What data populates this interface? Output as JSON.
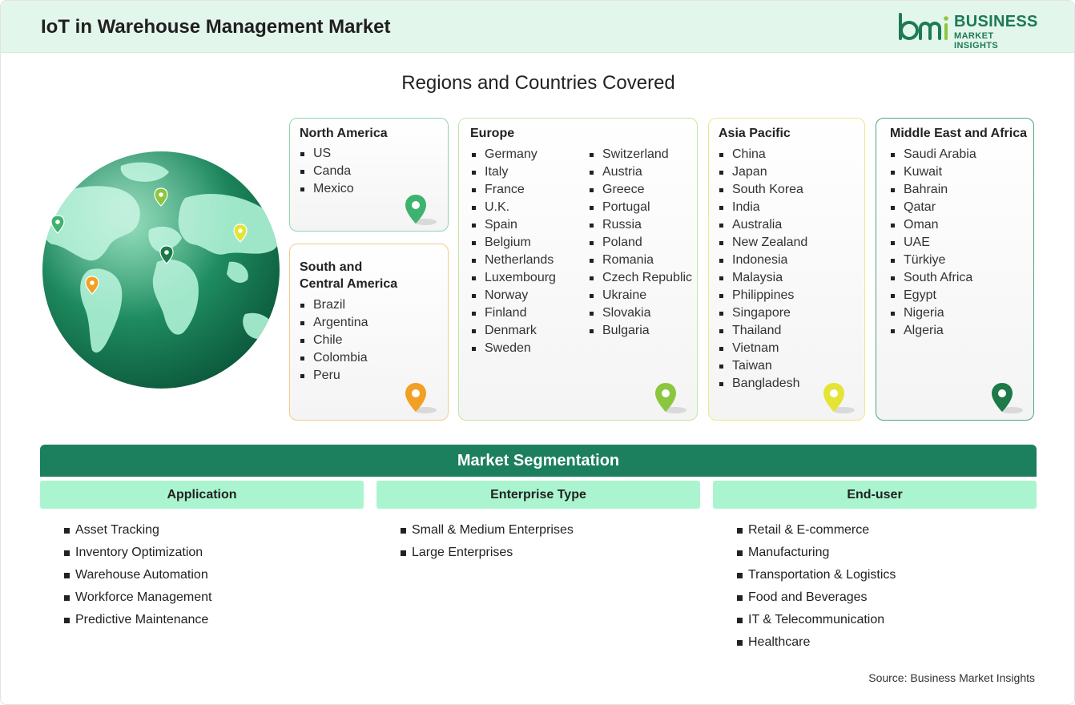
{
  "header": {
    "title": "IoT in Warehouse Management Market"
  },
  "logo": {
    "line1": "BUSINESS",
    "line2": "MARKET INSIGHTS"
  },
  "regions_title": "Regions and Countries Covered",
  "regions": {
    "north_america": {
      "name": "North America",
      "countries": [
        "US",
        "Canda",
        "Mexico"
      ],
      "pin_color": "#3db36e"
    },
    "south_central_america": {
      "name_line1": "South and",
      "name_line2": "Central America",
      "countries": [
        "Brazil",
        "Argentina",
        "Chile",
        "Colombia",
        "Peru"
      ],
      "pin_color": "#f2a024"
    },
    "europe": {
      "name": "Europe",
      "col1": [
        "Germany",
        "Italy",
        "France",
        "U.K.",
        "Spain",
        "Belgium",
        "Netherlands",
        "Luxembourg",
        "Norway",
        "Finland",
        "Denmark",
        "Sweden"
      ],
      "col2": [
        "Switzerland",
        "Austria",
        "Greece",
        "Portugal",
        "Russia",
        "Poland",
        "Romania",
        "Czech Republic",
        "Ukraine",
        "Slovakia",
        "Bulgaria"
      ],
      "pin_color": "#8cc63f"
    },
    "asia_pacific": {
      "name": "Asia Pacific",
      "countries": [
        "China",
        "Japan",
        "South Korea",
        "India",
        "Australia",
        "New Zealand",
        "Indonesia",
        "Malaysia",
        "Philippines",
        "Singapore",
        "Thailand",
        "Vietnam",
        "Taiwan",
        "Bangladesh"
      ],
      "pin_color": "#e5e436"
    },
    "middle_east_africa": {
      "name": "Middle East and Africa",
      "countries": [
        "Saudi Arabia",
        "Kuwait",
        "Bahrain",
        "Qatar",
        "Oman",
        "UAE",
        "Türkiye",
        "South Africa",
        "Egypt",
        "Nigeria",
        "Algeria"
      ],
      "pin_color": "#1b7a47"
    }
  },
  "segmentation": {
    "title": "Market Segmentation",
    "application": {
      "label": "Application",
      "items": [
        "Asset Tracking",
        "Inventory Optimization",
        "Warehouse Automation",
        "Workforce Management",
        "Predictive Maintenance"
      ]
    },
    "enterprise_type": {
      "label": "Enterprise Type",
      "items": [
        "Small & Medium Enterprises",
        "Large Enterprises"
      ]
    },
    "end_user": {
      "label": "End-user",
      "items": [
        "Retail & E-commerce",
        "Manufacturing",
        "Transportation & Logistics",
        "Food and Beverages",
        "IT & Telecommunication",
        "Healthcare"
      ]
    }
  },
  "source": "Source: Business Market Insights",
  "colors": {
    "brand": "#1d7a55",
    "segment_bar": "#1c7f5e",
    "segment_head": "#aaf5cf",
    "header_bg": "#e3f6ec"
  }
}
